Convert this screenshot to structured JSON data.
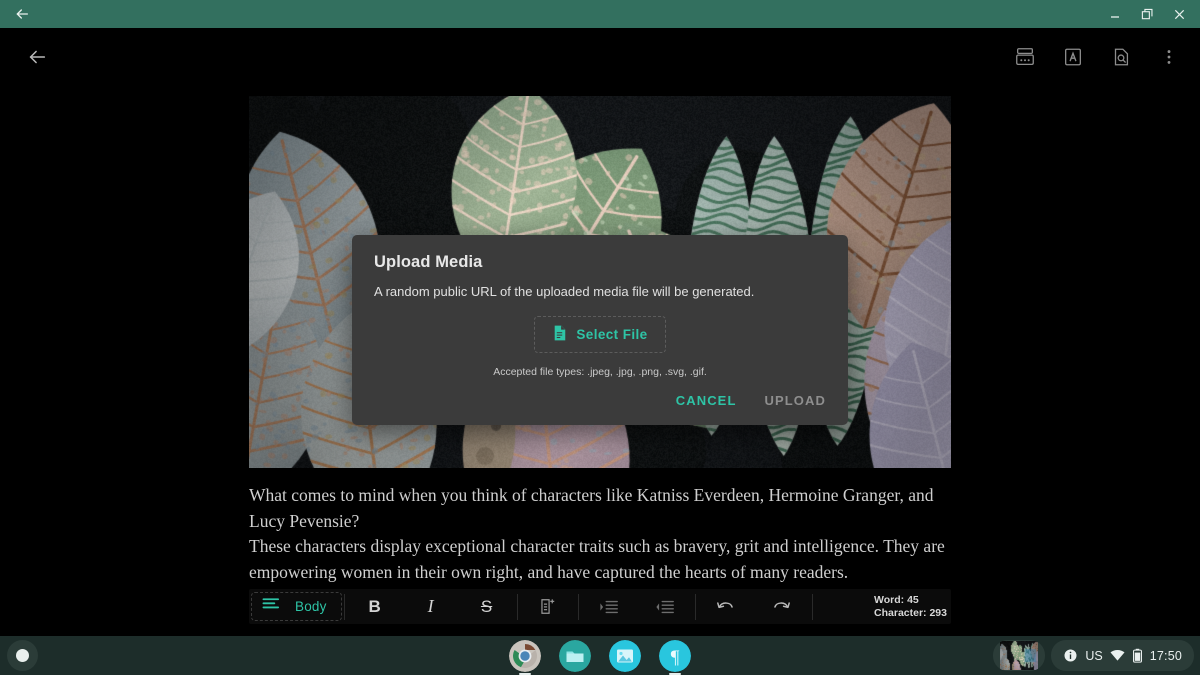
{
  "window": {
    "back_icon": "back-arrow-icon",
    "minimize_label": "minimize",
    "restore_label": "restore",
    "close_label": "close",
    "titlebar_color": "#33705f"
  },
  "app_bar": {
    "back_icon": "back-arrow-icon",
    "actions": [
      {
        "name": "media-tools-icon",
        "label": "Media tools"
      },
      {
        "name": "text-format-icon",
        "label": "Text format"
      },
      {
        "name": "find-in-document-icon",
        "label": "Find in document"
      },
      {
        "name": "more-options-icon",
        "label": "More options"
      }
    ]
  },
  "document": {
    "image_alt": "Caladium leaves photograph",
    "paragraphs": [
      "What comes to mind when you think of characters like Katniss Everdeen, Hermoine Granger, and Lucy Pevensie?",
      "These characters display exceptional character traits such as bravery, grit and intelligence. They are empowering women in their own right, and have captured the hearts of many readers."
    ]
  },
  "editor_toolbar": {
    "style_icon": "paragraph-style-icon",
    "style_label": "Body",
    "bold_label": "B",
    "italic_label": "I",
    "strikethrough_label": "S",
    "insert_note_icon": "add-note-icon",
    "indent_icon": "indent-increase-icon",
    "outdent_icon": "indent-decrease-icon",
    "undo_icon": "undo-icon",
    "redo_icon": "redo-icon",
    "word_count_label": "Word: 45",
    "character_count_label": "Character: 293",
    "accent_color": "#2ec4a6"
  },
  "upload_dialog": {
    "title": "Upload Media",
    "description": "A random public URL of the uploaded media file will be generated.",
    "select_file_icon": "file-icon",
    "select_file_label": "Select File",
    "accepted_types": "Accepted file types: .jpeg, .jpg, .png, .svg, .gif.",
    "cancel_label": "CANCEL",
    "upload_label": "UPLOAD",
    "accent_color": "#2ec4a6",
    "surface_color": "#3b3b3b"
  },
  "shelf": {
    "launcher_name": "launcher-button",
    "apps": [
      {
        "name": "shelf-app-chrome",
        "label": "Chrome",
        "active": true
      },
      {
        "name": "shelf-app-files",
        "label": "Files",
        "active": false
      },
      {
        "name": "shelf-app-gallery",
        "label": "Gallery",
        "active": false
      },
      {
        "name": "shelf-app-notes",
        "label": "Notes",
        "active": true
      }
    ],
    "status": {
      "notification_icon": "info-icon",
      "keyboard_layout": "US",
      "wifi_icon": "wifi-icon",
      "battery_icon": "battery-icon",
      "time": "17:50"
    }
  }
}
